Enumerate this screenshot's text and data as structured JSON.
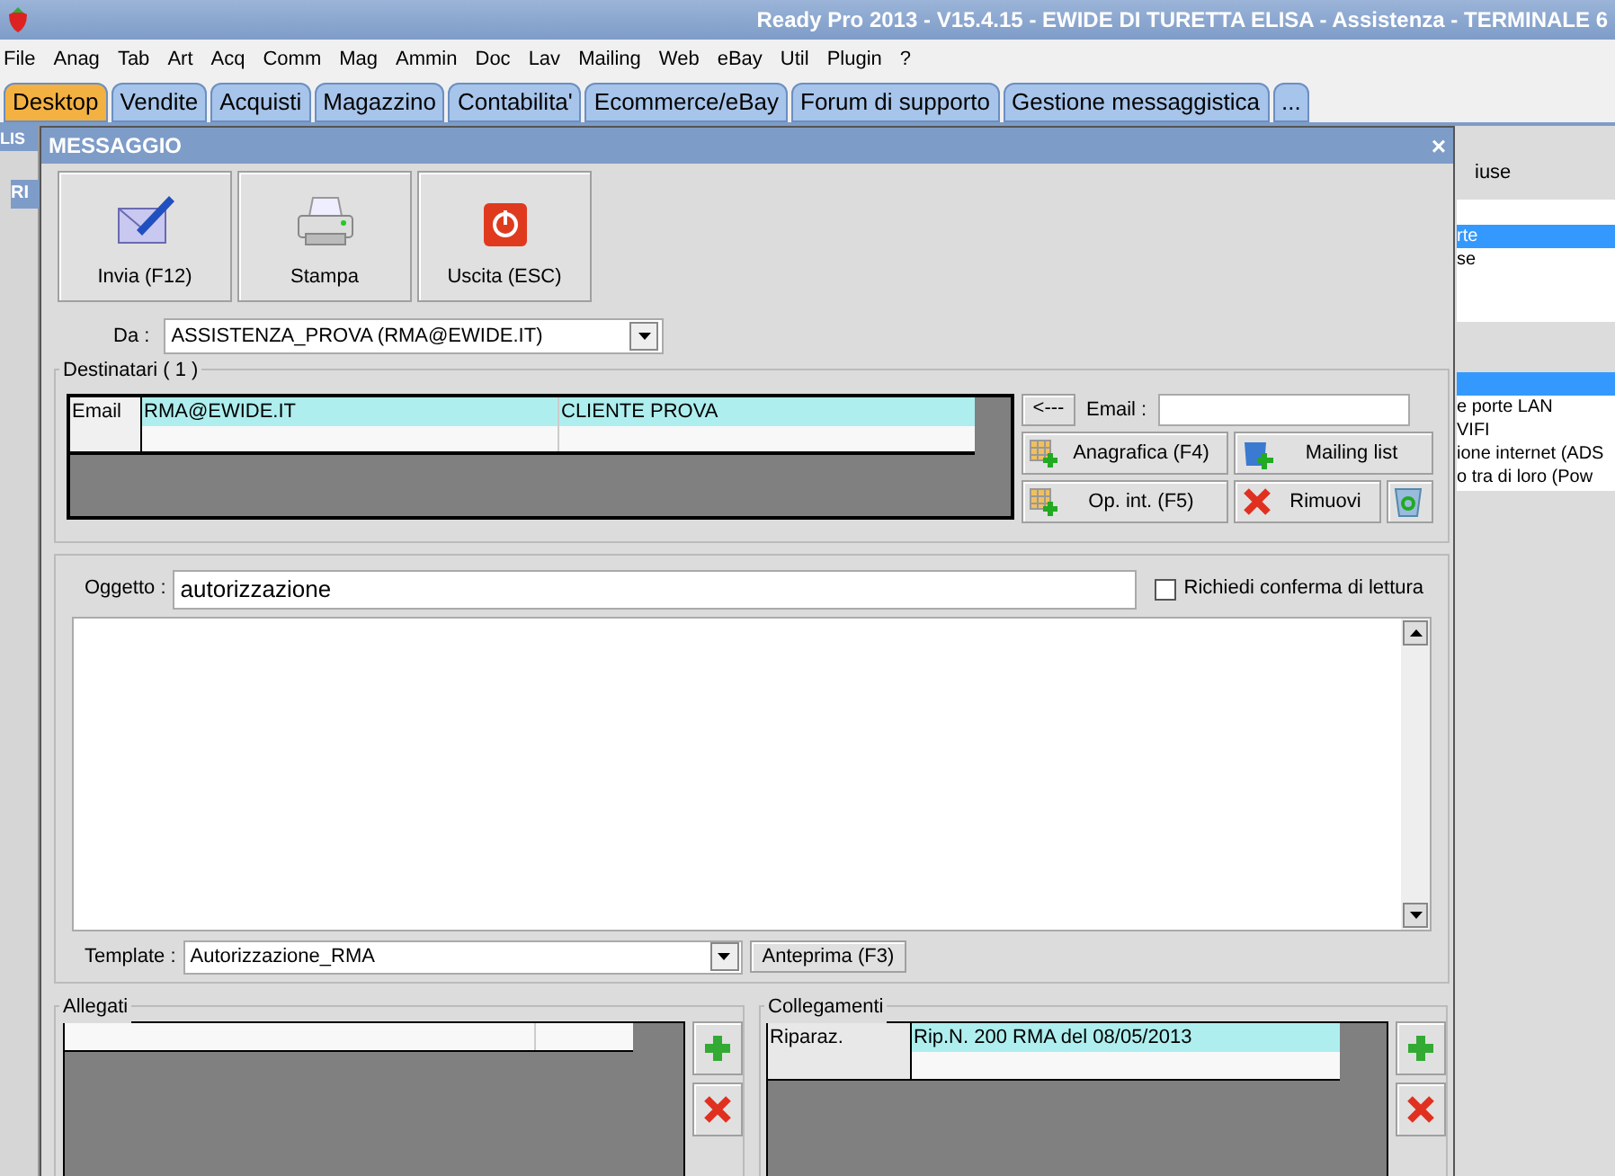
{
  "window": {
    "title": "Ready Pro 2013 - V15.4.15 - EWIDE DI TURETTA ELISA - Assistenza - TERMINALE 6"
  },
  "menu": [
    "File",
    "Anag",
    "Tab",
    "Art",
    "Acq",
    "Comm",
    "Mag",
    "Ammin",
    "Doc",
    "Lav",
    "Mailing",
    "Web",
    "eBay",
    "Util",
    "Plugin",
    "?"
  ],
  "tabs": [
    {
      "label": "Desktop",
      "selected": true
    },
    {
      "label": "Vendite",
      "selected": false
    },
    {
      "label": "Acquisti",
      "selected": false
    },
    {
      "label": "Magazzino",
      "selected": false
    },
    {
      "label": "Contabilita'",
      "selected": false
    },
    {
      "label": "Ecommerce/eBay",
      "selected": false
    },
    {
      "label": "Forum di supporto",
      "selected": false
    },
    {
      "label": "Gestione messaggistica",
      "selected": false
    },
    {
      "label": "...",
      "selected": false
    }
  ],
  "background_left": {
    "title": "LIS",
    "subtitle": "RI"
  },
  "background_right": {
    "group_label": "iuse",
    "top_list": [
      {
        "text": "rte",
        "selected": true
      },
      {
        "text": "se",
        "selected": false
      }
    ],
    "bottom_list": [
      {
        "selected": true
      },
      {
        "text": "e porte LAN",
        "selected": false
      },
      {
        "text": "VIFI",
        "selected": false
      },
      {
        "text": "ione internet (ADS",
        "selected": false
      },
      {
        "text": "o tra di loro (Pow",
        "selected": false
      }
    ]
  },
  "dialog": {
    "title": "MESSAGGIO",
    "close": "×",
    "toolbar": [
      {
        "kind": "send",
        "label": "Invia (F12)"
      },
      {
        "kind": "print",
        "label": "Stampa"
      },
      {
        "kind": "exit",
        "label": "Uscita (ESC)"
      }
    ],
    "from": {
      "label": "Da :",
      "value": "ASSISTENZA_PROVA (RMA@EWIDE.IT)"
    },
    "recipients": {
      "title": "Destinatari ( 1 )",
      "rows": [
        {
          "type": "Email",
          "address": "RMA@EWIDE.IT",
          "name": "CLIENTE PROVA"
        }
      ],
      "back_button": "<---",
      "email_label": "Email :",
      "buttons": [
        {
          "kind": "add",
          "label": "Anagrafica (F4)"
        },
        {
          "kind": "mailing",
          "label": "Mailing list"
        },
        {
          "kind": "add",
          "label": "Op. int. (F5)"
        },
        {
          "kind": "remove",
          "label": "Rimuovi"
        },
        {
          "kind": "bin"
        }
      ]
    },
    "subject": {
      "label": "Oggetto :",
      "value": "autorizzazione",
      "read_receipt": {
        "label": "Richiedi conferma di lettura",
        "checked": false
      }
    },
    "template": {
      "label": "Template :",
      "value": "Autorizzazione_RMA",
      "preview_button": "Anteprima (F3)"
    },
    "attachments": {
      "title": "Allegati"
    },
    "links": {
      "title": "Collegamenti",
      "rows": [
        {
          "type": "Riparaz.",
          "description": "Rip.N. 200 RMA del 08/05/2013"
        }
      ]
    }
  }
}
